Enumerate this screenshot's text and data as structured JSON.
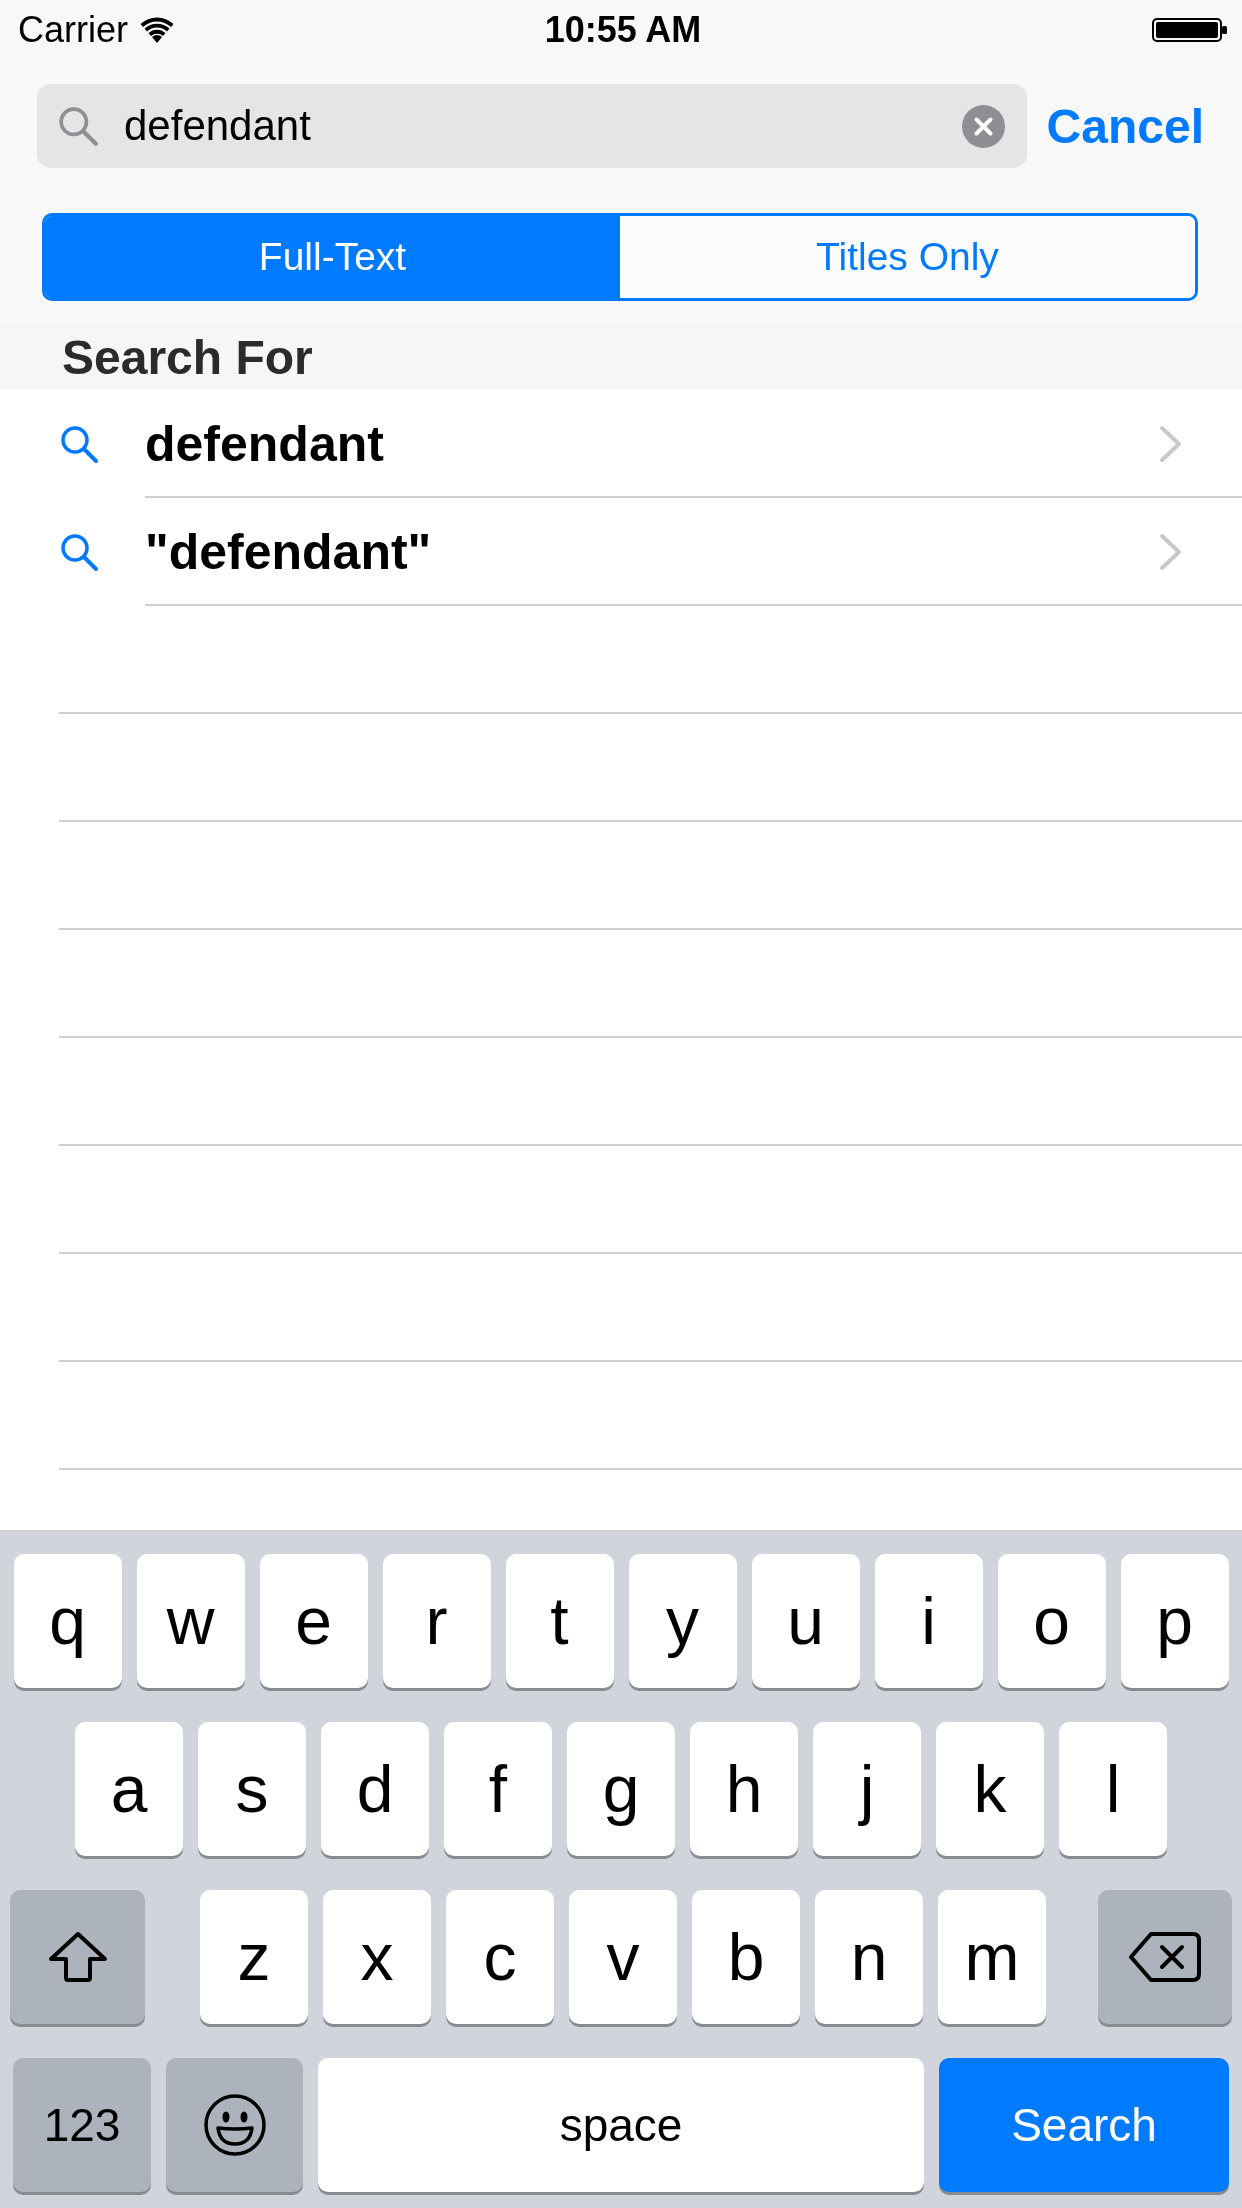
{
  "status_bar": {
    "carrier": "Carrier",
    "time": "10:55 AM"
  },
  "search": {
    "value": "defendant",
    "cancel": "Cancel"
  },
  "segments": [
    {
      "label": "Full-Text",
      "selected": true
    },
    {
      "label": "Titles Only",
      "selected": false
    }
  ],
  "section": {
    "title": "Search For"
  },
  "suggestions": [
    {
      "text": "defendant"
    },
    {
      "text": "\"defendant\""
    }
  ],
  "keyboard": {
    "letter_rows": [
      [
        {
          "kind": "letter",
          "label": "q"
        },
        {
          "kind": "letter",
          "label": "w"
        },
        {
          "kind": "letter",
          "label": "e"
        },
        {
          "kind": "letter",
          "label": "r"
        },
        {
          "kind": "letter",
          "label": "t"
        },
        {
          "kind": "letter",
          "label": "y"
        },
        {
          "kind": "letter",
          "label": "u"
        },
        {
          "kind": "letter",
          "label": "i"
        },
        {
          "kind": "letter",
          "label": "o"
        },
        {
          "kind": "letter",
          "label": "p"
        }
      ],
      [
        {
          "kind": "letter",
          "label": "a"
        },
        {
          "kind": "letter",
          "label": "s"
        },
        {
          "kind": "letter",
          "label": "d"
        },
        {
          "kind": "letter",
          "label": "f"
        },
        {
          "kind": "letter",
          "label": "g"
        },
        {
          "kind": "letter",
          "label": "h"
        },
        {
          "kind": "letter",
          "label": "j"
        },
        {
          "kind": "letter",
          "label": "k"
        },
        {
          "kind": "letter",
          "label": "l"
        }
      ],
      [
        {
          "kind": "shift"
        },
        {
          "kind": "letter",
          "label": "z"
        },
        {
          "kind": "letter",
          "label": "x"
        },
        {
          "kind": "letter",
          "label": "c"
        },
        {
          "kind": "letter",
          "label": "v"
        },
        {
          "kind": "letter",
          "label": "b"
        },
        {
          "kind": "letter",
          "label": "n"
        },
        {
          "kind": "letter",
          "label": "m"
        },
        {
          "kind": "delete"
        }
      ]
    ],
    "bottom_row": {
      "numbers_key": "123",
      "space_key": "space",
      "action_key": "Search"
    }
  }
}
